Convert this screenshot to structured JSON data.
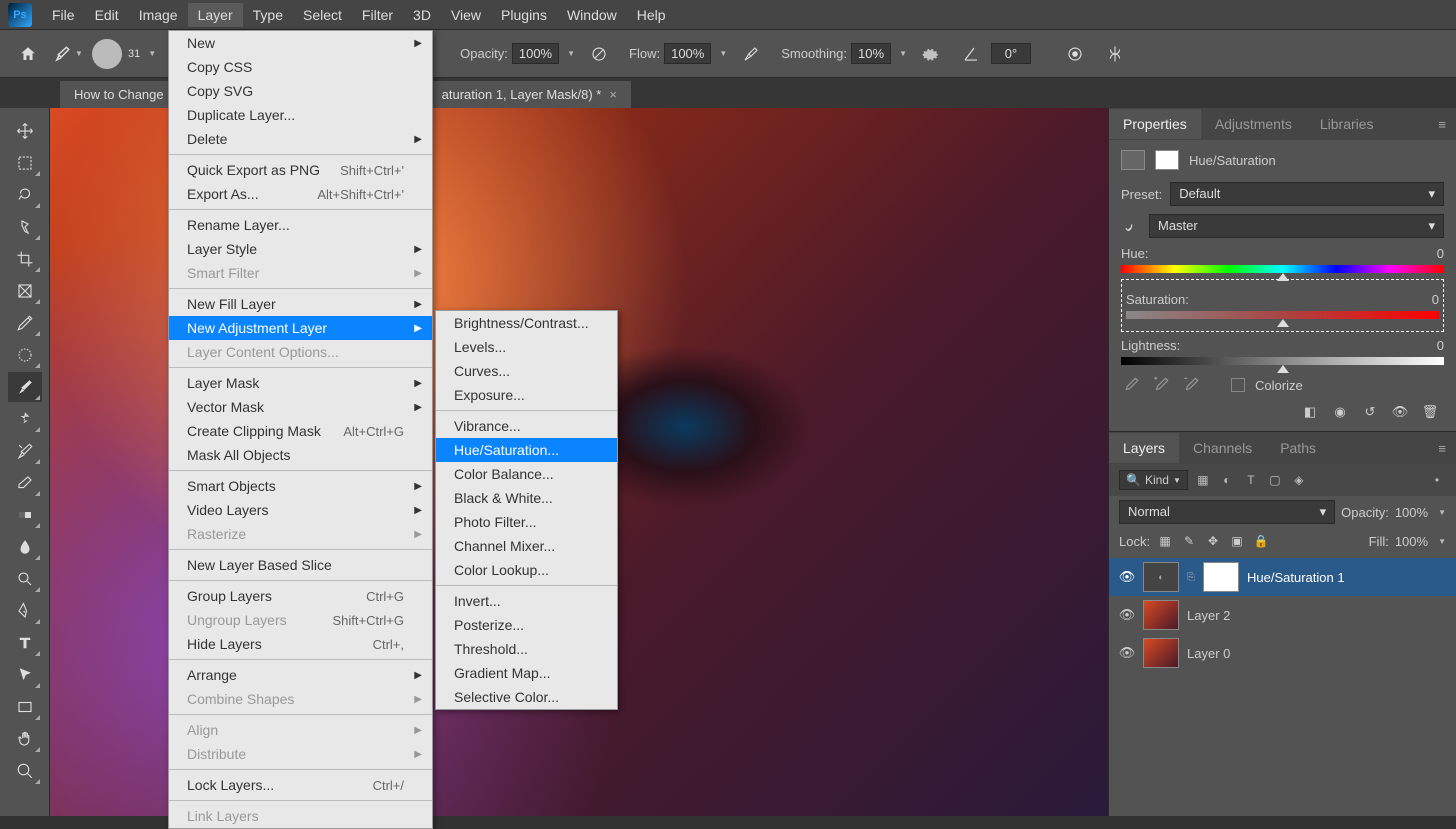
{
  "menubar": {
    "items": [
      "File",
      "Edit",
      "Image",
      "Layer",
      "Type",
      "Select",
      "Filter",
      "3D",
      "View",
      "Plugins",
      "Window",
      "Help"
    ],
    "open_index": 3
  },
  "toolbar": {
    "brush_size": "31",
    "opacity_label": "Opacity:",
    "opacity_value": "100%",
    "flow_label": "Flow:",
    "flow_value": "100%",
    "smoothing_label": "Smoothing:",
    "smoothing_value": "10%",
    "angle_value": "0°"
  },
  "document": {
    "tab_title": "How to Change",
    "tab_title_suffix": "aturation 1, Layer Mask/8) *"
  },
  "layer_menu": {
    "groups": [
      [
        {
          "label": "New",
          "arrow": true
        },
        {
          "label": "Copy CSS"
        },
        {
          "label": "Copy SVG"
        },
        {
          "label": "Duplicate Layer..."
        },
        {
          "label": "Delete",
          "arrow": true
        }
      ],
      [
        {
          "label": "Quick Export as PNG",
          "shortcut": "Shift+Ctrl+'"
        },
        {
          "label": "Export As...",
          "shortcut": "Alt+Shift+Ctrl+'"
        }
      ],
      [
        {
          "label": "Rename Layer..."
        },
        {
          "label": "Layer Style",
          "arrow": true
        },
        {
          "label": "Smart Filter",
          "arrow": true,
          "disabled": true
        }
      ],
      [
        {
          "label": "New Fill Layer",
          "arrow": true
        },
        {
          "label": "New Adjustment Layer",
          "arrow": true,
          "highlighted": true
        },
        {
          "label": "Layer Content Options...",
          "disabled": true
        }
      ],
      [
        {
          "label": "Layer Mask",
          "arrow": true
        },
        {
          "label": "Vector Mask",
          "arrow": true
        },
        {
          "label": "Create Clipping Mask",
          "shortcut": "Alt+Ctrl+G"
        },
        {
          "label": "Mask All Objects"
        }
      ],
      [
        {
          "label": "Smart Objects",
          "arrow": true
        },
        {
          "label": "Video Layers",
          "arrow": true
        },
        {
          "label": "Rasterize",
          "arrow": true,
          "disabled": true
        }
      ],
      [
        {
          "label": "New Layer Based Slice"
        }
      ],
      [
        {
          "label": "Group Layers",
          "shortcut": "Ctrl+G"
        },
        {
          "label": "Ungroup Layers",
          "shortcut": "Shift+Ctrl+G",
          "disabled": true
        },
        {
          "label": "Hide Layers",
          "shortcut": "Ctrl+,"
        }
      ],
      [
        {
          "label": "Arrange",
          "arrow": true
        },
        {
          "label": "Combine Shapes",
          "arrow": true,
          "disabled": true
        }
      ],
      [
        {
          "label": "Align",
          "arrow": true,
          "disabled": true
        },
        {
          "label": "Distribute",
          "arrow": true,
          "disabled": true
        }
      ],
      [
        {
          "label": "Lock Layers...",
          "shortcut": "Ctrl+/"
        }
      ],
      [
        {
          "label": "Link Layers",
          "disabled": true
        }
      ]
    ]
  },
  "adjustment_submenu": {
    "groups": [
      [
        {
          "label": "Brightness/Contrast..."
        },
        {
          "label": "Levels..."
        },
        {
          "label": "Curves..."
        },
        {
          "label": "Exposure..."
        }
      ],
      [
        {
          "label": "Vibrance..."
        },
        {
          "label": "Hue/Saturation...",
          "highlighted": true
        },
        {
          "label": "Color Balance..."
        },
        {
          "label": "Black & White..."
        },
        {
          "label": "Photo Filter..."
        },
        {
          "label": "Channel Mixer..."
        },
        {
          "label": "Color Lookup..."
        }
      ],
      [
        {
          "label": "Invert..."
        },
        {
          "label": "Posterize..."
        },
        {
          "label": "Threshold..."
        },
        {
          "label": "Gradient Map..."
        },
        {
          "label": "Selective Color..."
        }
      ]
    ]
  },
  "properties": {
    "tab_properties": "Properties",
    "tab_adjustments": "Adjustments",
    "tab_libraries": "Libraries",
    "title": "Hue/Saturation",
    "preset_label": "Preset:",
    "preset_value": "Default",
    "channel_value": "Master",
    "hue_label": "Hue:",
    "hue_value": "0",
    "saturation_label": "Saturation:",
    "saturation_value": "0",
    "lightness_label": "Lightness:",
    "lightness_value": "0",
    "colorize_label": "Colorize"
  },
  "layers": {
    "tab_layers": "Layers",
    "tab_channels": "Channels",
    "tab_paths": "Paths",
    "filter_kind": "Kind",
    "blend_mode": "Normal",
    "opacity_label": "Opacity:",
    "opacity_value": "100%",
    "lock_label": "Lock:",
    "fill_label": "Fill:",
    "fill_value": "100%",
    "items": [
      {
        "name": "Hue/Saturation 1",
        "type": "adjustment",
        "selected": true
      },
      {
        "name": "Layer 2",
        "type": "image"
      },
      {
        "name": "Layer 0",
        "type": "image"
      }
    ]
  }
}
